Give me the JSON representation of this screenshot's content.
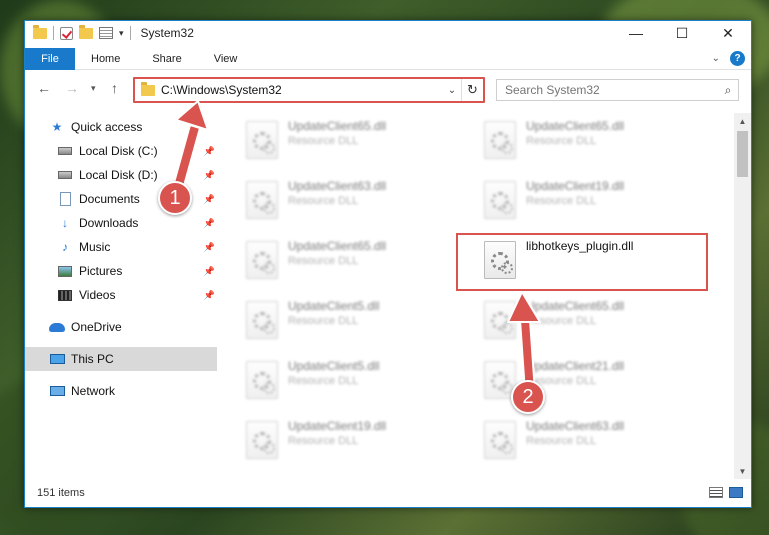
{
  "window": {
    "title": "System32",
    "controls": {
      "minimize": "—",
      "maximize": "☐",
      "close": "✕"
    }
  },
  "ribbon": {
    "tabs": [
      "File",
      "Home",
      "Share",
      "View"
    ],
    "help": "?"
  },
  "nav": {
    "address": "C:\\Windows\\System32",
    "search_placeholder": "Search System32"
  },
  "sidebar": {
    "items": [
      {
        "label": "Quick access",
        "icon": "star-icon"
      },
      {
        "label": "Local Disk (C:)",
        "icon": "drive-icon"
      },
      {
        "label": "Local Disk (D:)",
        "icon": "drive-icon"
      },
      {
        "label": "Documents",
        "icon": "documents-icon"
      },
      {
        "label": "Downloads",
        "icon": "downloads-icon"
      },
      {
        "label": "Music",
        "icon": "music-icon"
      },
      {
        "label": "Pictures",
        "icon": "pictures-icon"
      },
      {
        "label": "Videos",
        "icon": "videos-icon"
      },
      {
        "label": "OneDrive",
        "icon": "onedrive-icon"
      },
      {
        "label": "This PC",
        "icon": "this-pc-icon"
      },
      {
        "label": "Network",
        "icon": "network-icon"
      }
    ]
  },
  "files": [
    {
      "name": "UpdateClient65.dll",
      "type": "Resource DLL"
    },
    {
      "name": "UpdateClient65.dll",
      "type": "Resource DLL"
    },
    {
      "name": "UpdateClient63.dll",
      "type": "Resource DLL"
    },
    {
      "name": "UpdateClient19.dll",
      "type": "Resource DLL"
    },
    {
      "name": "UpdateClient65.dll",
      "type": "Resource DLL"
    },
    {
      "name": "libhotkeys_plugin.dll",
      "type": ""
    },
    {
      "name": "UpdateClient5.dll",
      "type": "Resource DLL"
    },
    {
      "name": "UpdateClient65.dll",
      "type": "Resource DLL"
    },
    {
      "name": "UpdateClient5.dll",
      "type": "Resource DLL"
    },
    {
      "name": "UpdateClient21.dll",
      "type": "Resource DLL"
    },
    {
      "name": "UpdateClient19.dll",
      "type": "Resource DLL"
    },
    {
      "name": "UpdateClient63.dll",
      "type": "Resource DLL"
    }
  ],
  "status": {
    "item_count": "151 items"
  },
  "annotations": {
    "step1": "1",
    "step2": "2",
    "accent_color": "#d9534f"
  }
}
